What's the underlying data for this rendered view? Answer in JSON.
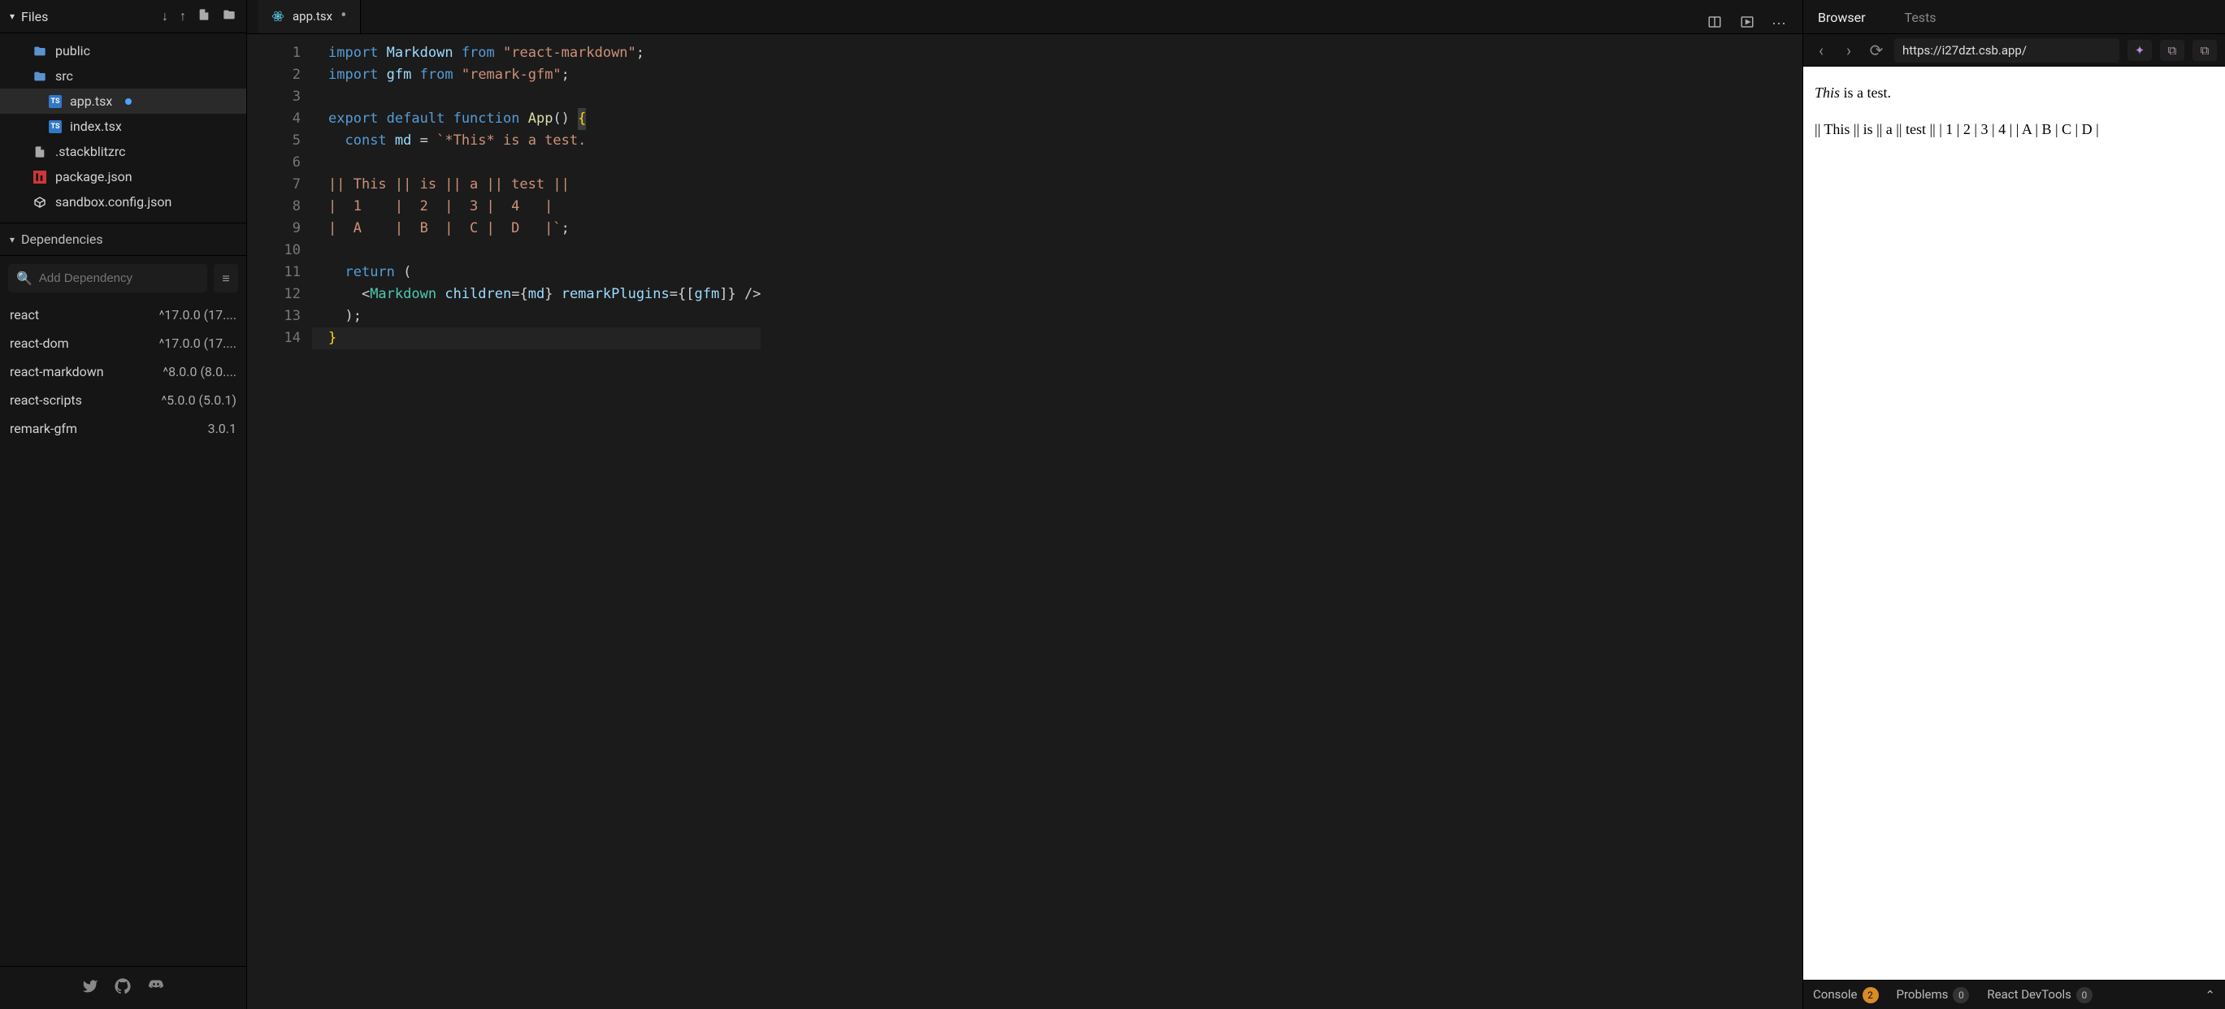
{
  "sidebar": {
    "title": "Files",
    "tree": [
      {
        "kind": "folder",
        "label": "public",
        "depth": 1
      },
      {
        "kind": "folder-open",
        "label": "src",
        "depth": 1
      },
      {
        "kind": "ts",
        "label": "app.tsx",
        "depth": 2,
        "active": true,
        "dirty": true
      },
      {
        "kind": "ts",
        "label": "index.tsx",
        "depth": 2
      },
      {
        "kind": "file",
        "label": ".stackblitzrc",
        "depth": 1
      },
      {
        "kind": "npm",
        "label": "package.json",
        "depth": 1
      },
      {
        "kind": "cfg",
        "label": "sandbox.config.json",
        "depth": 1
      }
    ],
    "deps_title": "Dependencies",
    "add_placeholder": "Add Dependency",
    "deps": [
      {
        "name": "react",
        "ver": "^17.0.0 (17...."
      },
      {
        "name": "react-dom",
        "ver": "^17.0.0 (17...."
      },
      {
        "name": "react-markdown",
        "ver": "^8.0.0 (8.0...."
      },
      {
        "name": "react-scripts",
        "ver": "^5.0.0 (5.0.1)"
      },
      {
        "name": "remark-gfm",
        "ver": "3.0.1"
      }
    ]
  },
  "editor": {
    "tab_label": "app.tsx",
    "lines": [
      "import Markdown from \"react-markdown\";",
      "import gfm from \"remark-gfm\";",
      "",
      "export default function App() {",
      "  const md = `*This* is a test.",
      "",
      "|| This || is || a || test ||",
      "|  1    |  2  |  3 |  4   |",
      "|  A    |  B  |  C |  D   |`;",
      "",
      "  return (",
      "    <Markdown children={md} remarkPlugins={[gfm]} />",
      "  );",
      "}"
    ]
  },
  "preview": {
    "tabs": {
      "browser": "Browser",
      "tests": "Tests"
    },
    "url": "https://i27dzt.csb.app/",
    "body_italic": "This",
    "body_rest": " is a test.",
    "body_line2": "|| This || is || a || test || | 1 | 2 | 3 | 4 | | A | B | C | D |",
    "bottom": {
      "console": "Console",
      "console_count": "2",
      "problems": "Problems",
      "problems_count": "0",
      "devtools": "React DevTools",
      "devtools_count": "0"
    }
  }
}
